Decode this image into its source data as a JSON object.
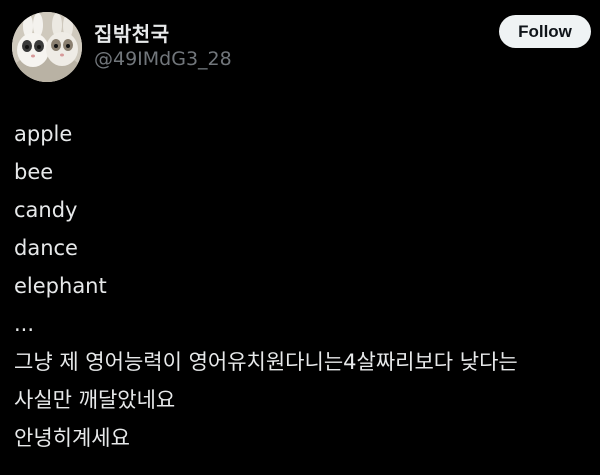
{
  "profile": {
    "display_name": "집밖천국",
    "handle": "@49IMdG3_28",
    "avatar_icon": "rabbit-avatar-icon"
  },
  "follow_button": {
    "label": "Follow"
  },
  "post": {
    "lines": [
      "apple",
      "bee",
      "candy",
      "dance",
      "elephant",
      "...",
      "그냥 제 영어능력이 영어유치원다니는4살짜리보다 낮다는",
      "사실만 깨달았네요",
      "안녕히계세요"
    ]
  },
  "colors": {
    "background": "#000000",
    "text": "#e7e9ea",
    "secondary_text": "#71767b",
    "button_bg": "#eff3f4",
    "button_text": "#0f1419"
  }
}
